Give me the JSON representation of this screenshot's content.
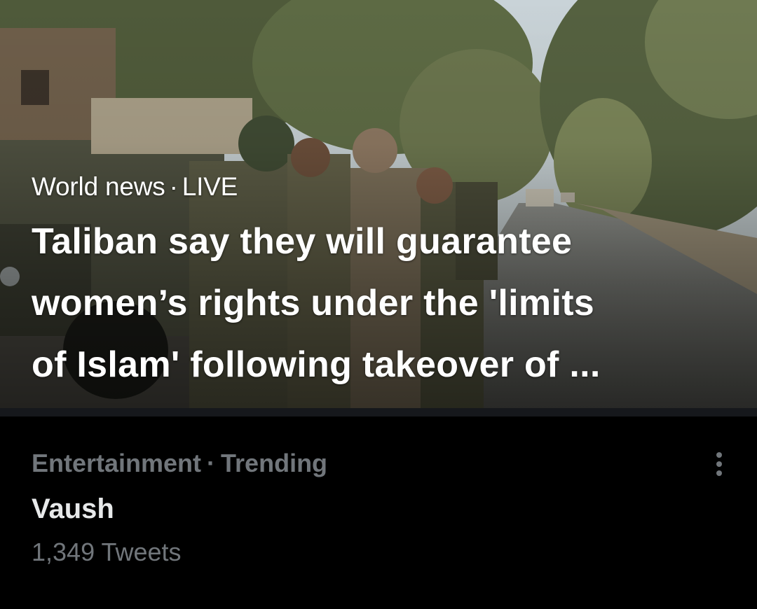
{
  "hero": {
    "category": "World news",
    "separator": "·",
    "status": "LIVE",
    "headline_lines": [
      "Taliban say they will guarantee",
      "women’s rights under the 'limits",
      "of Islam' following takeover of ..."
    ],
    "image_icon": "news-photo-soldiers-street"
  },
  "trend": {
    "category": "Entertainment",
    "separator": "·",
    "label": "Trending",
    "name": "Vaush",
    "count": "1,349 Tweets",
    "more_icon": "more-vertical-icon"
  },
  "colors": {
    "background": "#000000",
    "primary_text": "#e7e9ea",
    "secondary_text": "#71767b",
    "divider": "#16181c"
  }
}
